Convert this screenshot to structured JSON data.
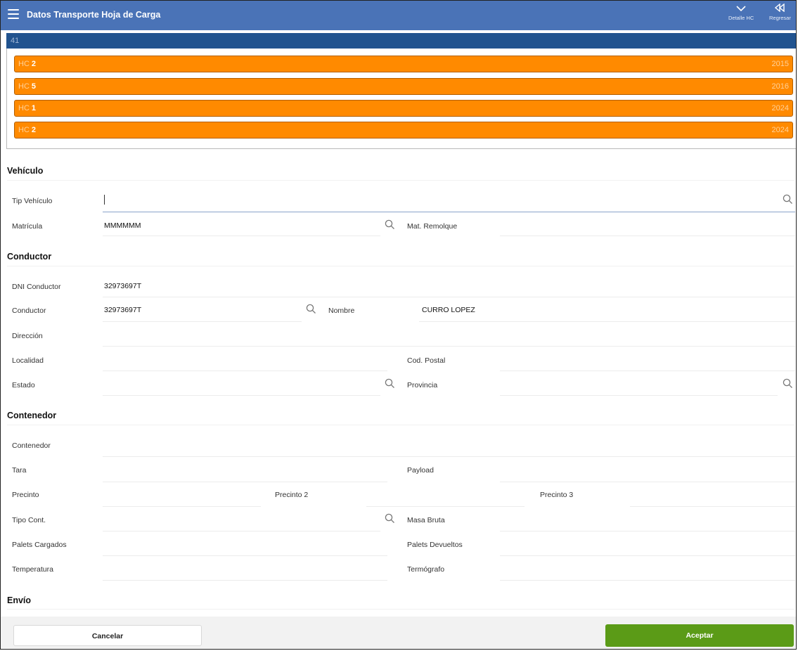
{
  "header": {
    "title": "Datos Transporte Hoja de Carga",
    "detail_label": "Detalle HC",
    "back_label": "Regresar"
  },
  "hc_group": {
    "label": "41",
    "items": [
      {
        "prefix": "HC",
        "number": "2",
        "year": "2015"
      },
      {
        "prefix": "HC",
        "number": "5",
        "year": "2016"
      },
      {
        "prefix": "HC",
        "number": "1",
        "year": "2024"
      },
      {
        "prefix": "HC",
        "number": "2",
        "year": "2024"
      }
    ]
  },
  "vehiculo": {
    "title": "Vehículo",
    "tip_vehiculo_label": "Tip Vehículo",
    "tip_vehiculo_value": "",
    "matricula_label": "Matrícula",
    "matricula_value": "MMMMMM",
    "mat_remolque_label": "Mat. Remolque"
  },
  "conductor": {
    "title": "Conductor",
    "dni_label": "DNI Conductor",
    "dni_value": "32973697T",
    "conductor_label": "Conductor",
    "conductor_value": "32973697T",
    "nombre_label": "Nombre",
    "nombre_value": "CURRO LOPEZ",
    "direccion_label": "Dirección",
    "localidad_label": "Localidad",
    "cod_postal_label": "Cod. Postal",
    "estado_label": "Estado",
    "provincia_label": "Provincia"
  },
  "contenedor": {
    "title": "Contenedor",
    "contenedor_label": "Contenedor",
    "tara_label": "Tara",
    "payload_label": "Payload",
    "precinto_label": "Precinto",
    "precinto2_label": "Precinto 2",
    "precinto3_label": "Precinto 3",
    "tipo_cont_label": "Tipo Cont.",
    "masa_bruta_label": "Masa Bruta",
    "palets_cargados_label": "Palets Cargados",
    "palets_devueltos_label": "Palets Devueltos",
    "temperatura_label": "Temperatura",
    "termografo_label": "Termógrafo"
  },
  "envio": {
    "title": "Envío"
  },
  "footer": {
    "cancel_label": "Cancelar",
    "accept_label": "Aceptar"
  },
  "colors": {
    "topbar": "#4a73b7",
    "hc_header": "#21538f",
    "hc_row": "#ff8a00",
    "accept": "#5b9b17"
  },
  "icons": [
    "menu-icon",
    "chevron-down-icon",
    "back-icon",
    "search-icon"
  ]
}
